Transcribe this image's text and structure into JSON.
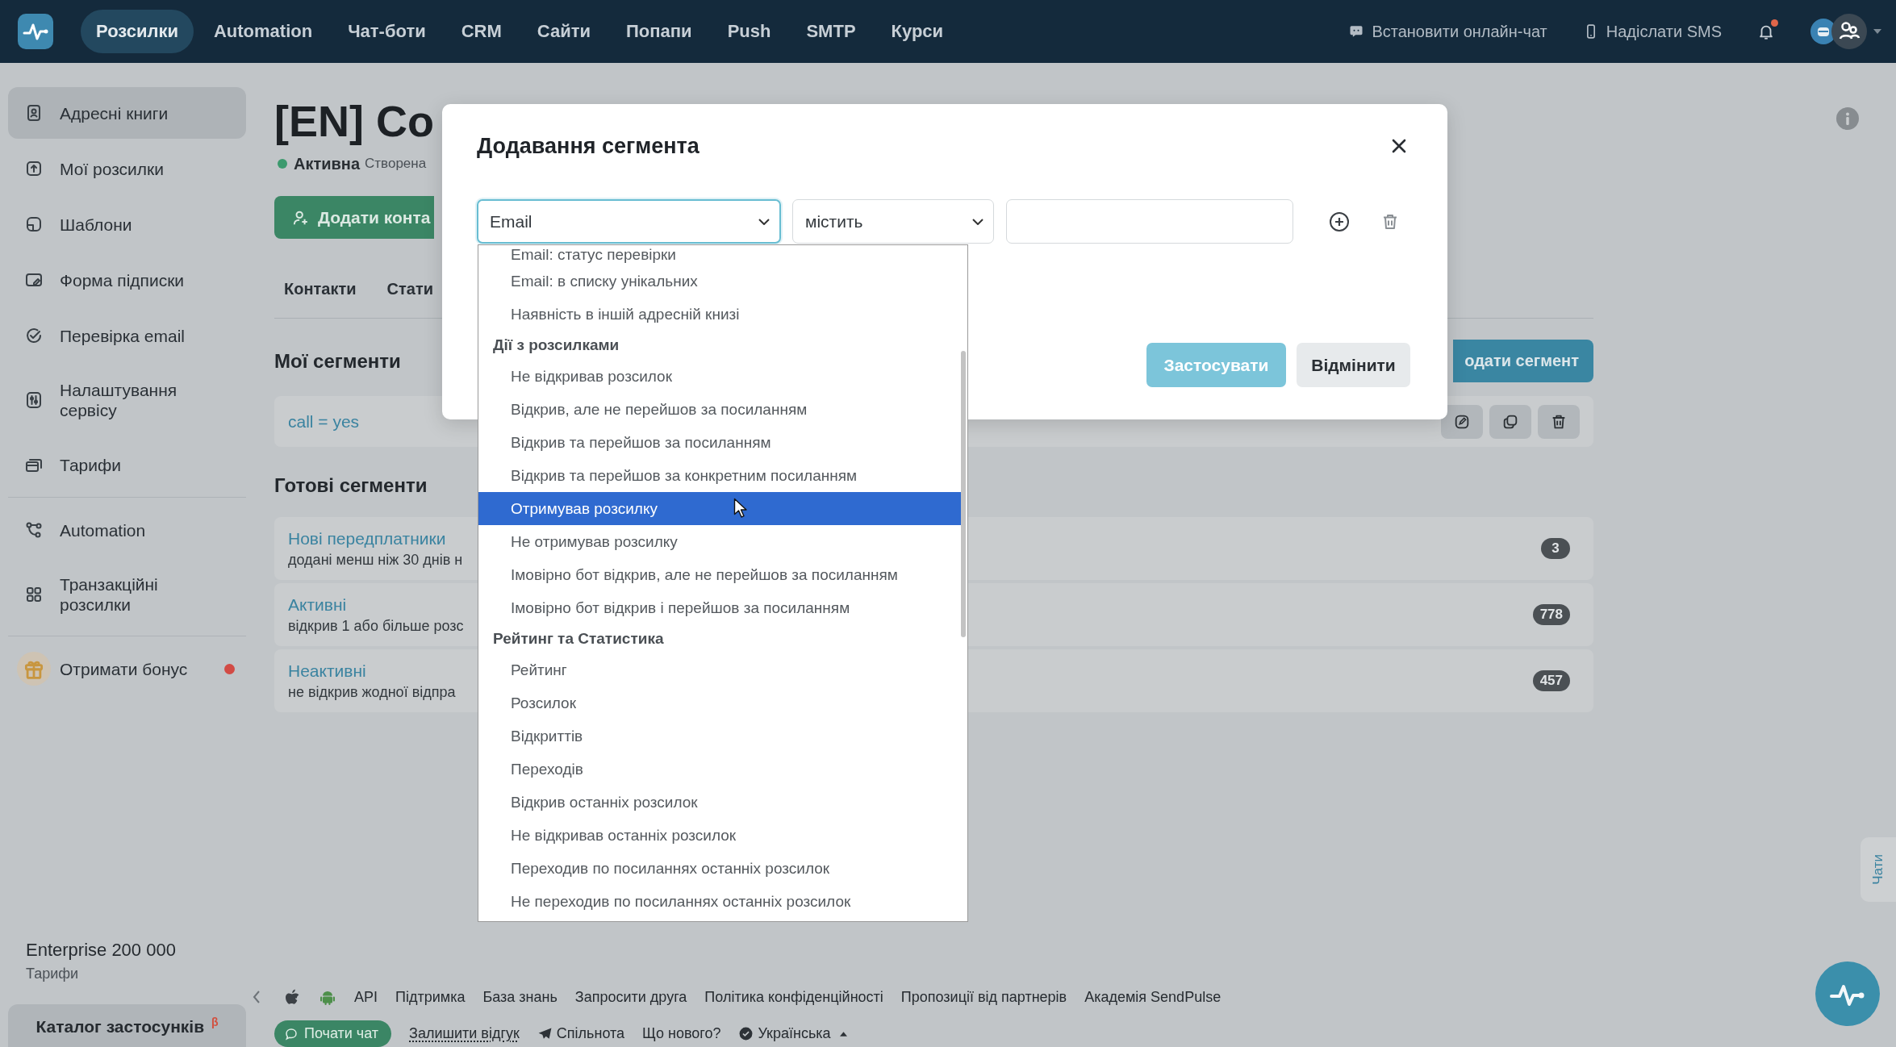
{
  "top_nav": {
    "items": [
      {
        "label": "Розсилки",
        "selected": true
      },
      {
        "label": "Automation",
        "selected": false
      },
      {
        "label": "Чат-боти",
        "selected": false
      },
      {
        "label": "CRM",
        "selected": false
      },
      {
        "label": "Сайти",
        "selected": false
      },
      {
        "label": "Попапи",
        "selected": false
      },
      {
        "label": "Push",
        "selected": false
      },
      {
        "label": "SMTP",
        "selected": false
      },
      {
        "label": "Курси",
        "selected": false
      }
    ],
    "actions": [
      {
        "label": "Встановити онлайн-чат"
      },
      {
        "label": "Надіслати SMS"
      }
    ],
    "bell": {
      "unread": true
    }
  },
  "sidebar": {
    "groups": [
      {
        "items": [
          {
            "label": "Адресні книги",
            "selected": true,
            "notification": false
          },
          {
            "label": "Мої розсилки",
            "selected": false,
            "notification": false
          },
          {
            "label": "Шаблони",
            "selected": false,
            "notification": false
          },
          {
            "label": "Форма підписки",
            "selected": false,
            "notification": false
          },
          {
            "label": "Перевірка email",
            "selected": false,
            "notification": false
          },
          {
            "label": "Налаштування сервісу",
            "selected": false,
            "notification": false
          },
          {
            "label": "Тарифи",
            "selected": false,
            "notification": false
          }
        ]
      },
      {
        "items": [
          {
            "label": "Automation",
            "selected": false,
            "notification": false
          },
          {
            "label": "Транзакційні розсилки",
            "selected": false,
            "notification": false
          }
        ]
      },
      {
        "items": [
          {
            "label": "Отримати бонус",
            "selected": false,
            "notification": true
          }
        ]
      }
    ],
    "plan": {
      "name": "Enterprise 200 000",
      "link": "Тарифи"
    },
    "catalog_button": "Каталог застосунків $^{β}$"
  },
  "list_page": {
    "title": "[EN] Co",
    "status": "Активна",
    "created": "Створена",
    "add_contact_button": "Додати конта",
    "tabs": [
      {
        "label": "Контакти",
        "selected": false
      },
      {
        "label": "Стати",
        "selected": false
      }
    ],
    "my_segments": {
      "title": "Мої сегменти",
      "add_button": "одати сегмент",
      "rows": [
        {
          "name": "call = yes"
        }
      ]
    },
    "ready_segments": {
      "title": "Готові сегменти",
      "rows": [
        {
          "name": "Нові передплатники",
          "description": "додані менш ніж 30 днів н",
          "count": "3"
        },
        {
          "name": "Активні",
          "description": "відкрив 1 або більше розс",
          "count": "778"
        },
        {
          "name": "Неактивні",
          "description": "не відкрив жодної відпра",
          "count": "457"
        }
      ]
    }
  },
  "modal": {
    "title": "Додавання сегмента",
    "condition": {
      "field": {
        "value": "Email",
        "focused": true,
        "expanded": true
      },
      "operator": {
        "value": "містить"
      }
    },
    "dropdown": {
      "items": [
        {
          "kind": "option",
          "label": "Email: статус перевірки",
          "selected": false
        },
        {
          "kind": "option",
          "label": "Email: в списку унікальних",
          "selected": false
        },
        {
          "kind": "option",
          "label": "Наявність в іншій адресній книзі",
          "selected": false
        },
        {
          "kind": "group",
          "label": "Дії з розсилками"
        },
        {
          "kind": "option",
          "label": "Не відкривав розсилок",
          "selected": false
        },
        {
          "kind": "option",
          "label": "Відкрив, але не перейшов за посиланням",
          "selected": false
        },
        {
          "kind": "option",
          "label": "Відкрив та перейшов за посиланням",
          "selected": false
        },
        {
          "kind": "option",
          "label": "Відкрив та перейшов за конкретним посиланням",
          "selected": false
        },
        {
          "kind": "option",
          "label": "Отримував розсилку",
          "selected": true
        },
        {
          "kind": "option",
          "label": "Не отримував розсилку",
          "selected": false
        },
        {
          "kind": "option",
          "label": "Імовірно бот відкрив, але не перейшов за посиланням",
          "selected": false
        },
        {
          "kind": "option",
          "label": "Імовірно бот відкрив і перейшов за посиланням",
          "selected": false
        },
        {
          "kind": "group",
          "label": "Рейтинг та Статистика"
        },
        {
          "kind": "option",
          "label": "Рейтинг",
          "selected": false
        },
        {
          "kind": "option",
          "label": "Розсилок",
          "selected": false
        },
        {
          "kind": "option",
          "label": "Відкриттів",
          "selected": false
        },
        {
          "kind": "option",
          "label": "Переходів",
          "selected": false
        },
        {
          "kind": "option",
          "label": "Відкрив останніх розсилок",
          "selected": false
        },
        {
          "kind": "option",
          "label": "Не відкривав останніх розсилок",
          "selected": false
        },
        {
          "kind": "option",
          "label": "Переходив по посиланнях останніх розсилок",
          "selected": false
        },
        {
          "kind": "option",
          "label": "Не переходив по посиланнях останніх розсилок",
          "selected": false
        }
      ]
    },
    "buttons": {
      "apply": {
        "label": "Застосувати",
        "disabled": true
      },
      "cancel": {
        "label": "Відмінити"
      }
    }
  },
  "footer": {
    "links": [
      "API",
      "Підтримка",
      "База знань",
      "Запросити друга",
      "Політика конфіденційності",
      "Пропозиції від партнерів",
      "Академія SendPulse"
    ],
    "chat_button": "Почати чат",
    "feedback_link": "Залишити відгук",
    "community_link": "Спільнота",
    "whats_new_link": "Що нового?",
    "language": "Українська"
  },
  "chats_tab": "Чати"
}
